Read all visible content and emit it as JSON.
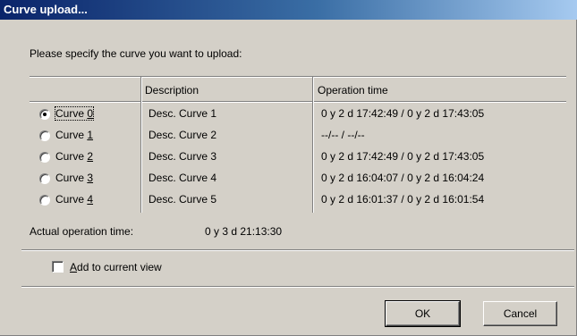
{
  "dialog": {
    "title": "Curve upload...",
    "prompt": "Please specify the curve you want to upload:"
  },
  "table": {
    "headers": [
      "",
      "Description",
      "Operation time"
    ],
    "rows": [
      {
        "label": "Curve ",
        "mnemonic": "0",
        "description": "Desc. Curve 1",
        "operation_time": "0 y 2 d 17:42:49 / 0 y 2 d 17:43:05",
        "selected": true
      },
      {
        "label": "Curve ",
        "mnemonic": "1",
        "description": "Desc. Curve 2",
        "operation_time": "--/-- / --/--",
        "selected": false
      },
      {
        "label": "Curve ",
        "mnemonic": "2",
        "description": "Desc. Curve 3",
        "operation_time": "0 y 2 d 17:42:49 / 0 y 2 d 17:43:05",
        "selected": false
      },
      {
        "label": "Curve ",
        "mnemonic": "3",
        "description": "Desc. Curve 4",
        "operation_time": "0 y 2 d 16:04:07 / 0 y 2 d 16:04:24",
        "selected": false
      },
      {
        "label": "Curve ",
        "mnemonic": "4",
        "description": "Desc. Curve 5",
        "operation_time": "0 y 2 d 16:01:37 / 0 y 2 d 16:01:54",
        "selected": false
      }
    ]
  },
  "actual": {
    "label": "Actual operation time:",
    "value": "0 y 3 d 21:13:30"
  },
  "add_to_view": {
    "mnemonic": "A",
    "label_rest": "dd to current view",
    "checked": false
  },
  "buttons": {
    "ok": "OK",
    "cancel": "Cancel"
  }
}
